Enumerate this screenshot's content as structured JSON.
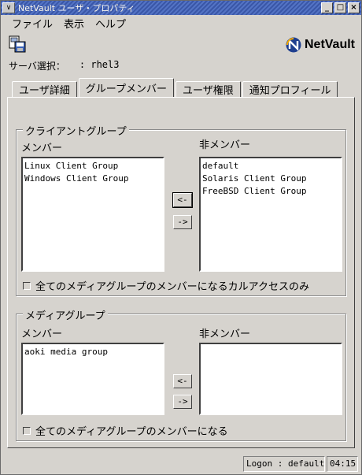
{
  "window": {
    "title": "NetVault ユーザ・プロパティ",
    "menu_icon": "∨",
    "minimize": "_",
    "maximize": "□",
    "close": "×"
  },
  "menu": {
    "items": [
      "ファイル",
      "表示",
      "ヘルプ"
    ]
  },
  "brand": {
    "name": "NetVault"
  },
  "server": {
    "label": "サーバ選択：",
    "value": ": rhel3"
  },
  "tabs": [
    {
      "label": "ユーザ詳細"
    },
    {
      "label": "グループメンバー"
    },
    {
      "label": "ユーザ権限"
    },
    {
      "label": "通知プロフィール"
    }
  ],
  "client_group": {
    "title": "クライアントグループ",
    "members_label": "メンバー",
    "non_members_label": "非メンバー",
    "members": [
      "Linux Client Group",
      "Windows Client Group"
    ],
    "non_members": [
      "default",
      "Solaris Client Group",
      "FreeBSD Client Group"
    ],
    "add_button": "<-",
    "remove_button": "->",
    "checkbox_label": "全てのメディアグループのメンバーになるカルアクセスのみ"
  },
  "media_group": {
    "title": "メディアグループ",
    "members_label": "メンバー",
    "non_members_label": "非メンバー",
    "members": [
      "aoki media group"
    ],
    "non_members": [],
    "add_button": "<-",
    "remove_button": "->",
    "checkbox_label": "全てのメディアグループのメンバーになる"
  },
  "status": {
    "logon": "Logon : default",
    "time": "04:15"
  }
}
